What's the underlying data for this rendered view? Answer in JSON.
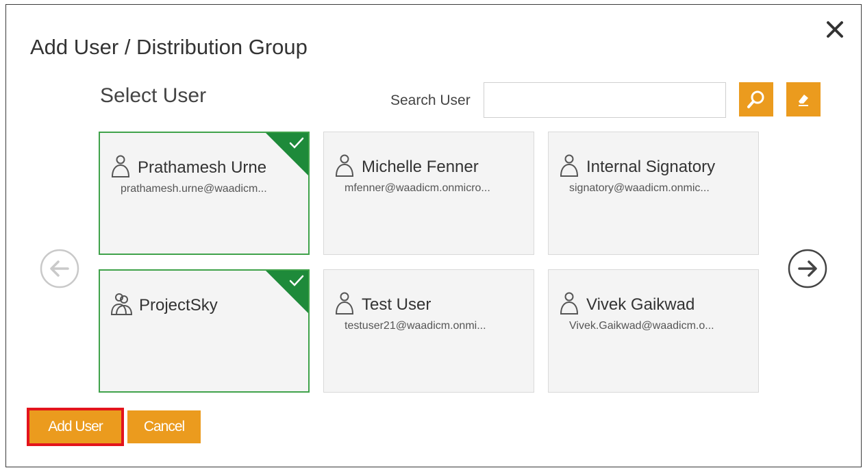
{
  "dialog": {
    "title": "Add User / Distribution Group",
    "subtitle": "Select User"
  },
  "search": {
    "label": "Search User",
    "value": "",
    "placeholder": ""
  },
  "users": [
    {
      "name": "Prathamesh Urne",
      "email": "prathamesh.urne@waadicm...",
      "selected": true,
      "type": "user"
    },
    {
      "name": "Michelle Fenner",
      "email": "mfenner@waadicm.onmicro...",
      "selected": false,
      "type": "user"
    },
    {
      "name": "Internal Signatory",
      "email": "signatory@waadicm.onmic...",
      "selected": false,
      "type": "user"
    },
    {
      "name": "ProjectSky",
      "email": "",
      "selected": true,
      "type": "group"
    },
    {
      "name": "Test User",
      "email": "testuser21@waadicm.onmi...",
      "selected": false,
      "type": "user"
    },
    {
      "name": "Vivek Gaikwad",
      "email": "Vivek.Gaikwad@waadicm.o...",
      "selected": false,
      "type": "user"
    }
  ],
  "actions": {
    "add_label": "Add User",
    "cancel_label": "Cancel"
  },
  "icons": {
    "close": "close-icon",
    "search": "search-icon",
    "clear": "eraser-icon",
    "prev": "arrow-left-icon",
    "next": "arrow-right-icon"
  },
  "colors": {
    "accent": "#eb9b1e",
    "selected_border": "#3fa24a",
    "selected_corner": "#1e8a3a",
    "highlight": "#e3141c"
  }
}
